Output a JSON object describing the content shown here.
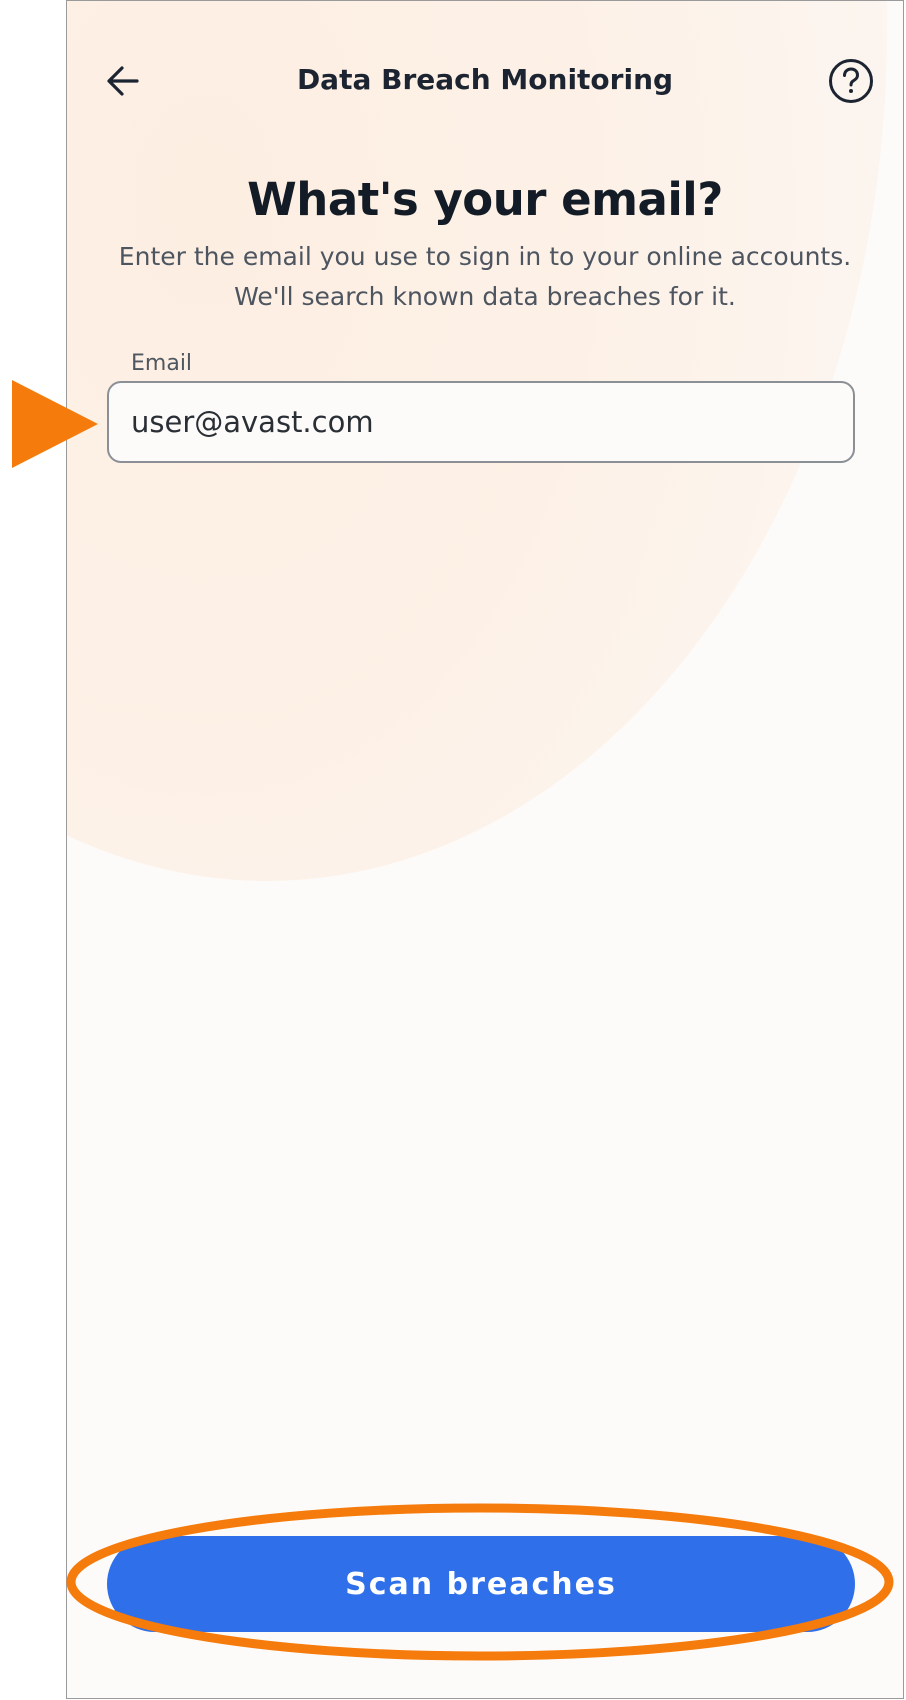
{
  "header": {
    "title": "Data Breach Monitoring",
    "back_icon": "arrow-left-icon",
    "help_icon": "question-circle-icon"
  },
  "main": {
    "headline": "What's your email?",
    "subtitle": "Enter the email you use to sign in to your online accounts. We'll search known data breaches for it.",
    "email_label": "Email",
    "email_value": "user@avast.com"
  },
  "actions": {
    "scan_label": "Scan breaches"
  },
  "colors": {
    "primary": "#2f6fe9",
    "annotation": "#f57b0c",
    "text_dark": "#131c26",
    "background": "#fdfbf9"
  }
}
